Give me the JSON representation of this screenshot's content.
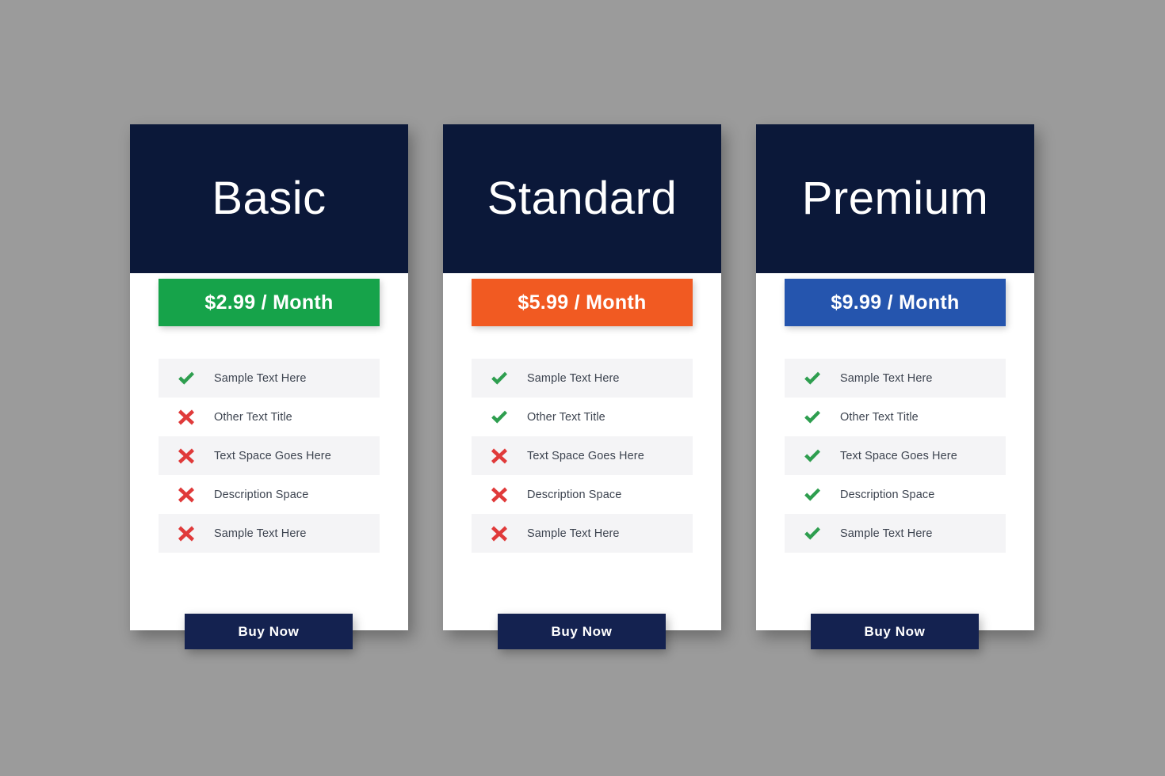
{
  "page": {
    "background_color": "#9b9b9b",
    "card_background": "#ffffff",
    "header_color": "#0b1839",
    "button_color": "#142250",
    "row_shade_color": "#f4f4f6",
    "label_color": "#3d4450",
    "check_color": "#2e9e4f",
    "cross_color": "#e03a3a"
  },
  "plans": [
    {
      "title": "Basic",
      "price": "$2.99 / Month",
      "accent_color": "#16a34a",
      "buy_label": "Buy Now",
      "features": [
        {
          "label": "Sample Text Here",
          "included": true
        },
        {
          "label": "Other Text Title",
          "included": false
        },
        {
          "label": "Text Space Goes Here",
          "included": false
        },
        {
          "label": "Description Space",
          "included": false
        },
        {
          "label": "Sample Text Here",
          "included": false
        }
      ]
    },
    {
      "title": "Standard",
      "price": "$5.99 / Month",
      "accent_color": "#f15a22",
      "buy_label": "Buy Now",
      "features": [
        {
          "label": "Sample Text Here",
          "included": true
        },
        {
          "label": "Other Text Title",
          "included": true
        },
        {
          "label": "Text Space Goes Here",
          "included": false
        },
        {
          "label": "Description Space",
          "included": false
        },
        {
          "label": "Sample Text Here",
          "included": false
        }
      ]
    },
    {
      "title": "Premium",
      "price": "$9.99 / Month",
      "accent_color": "#2555ae",
      "buy_label": "Buy Now",
      "features": [
        {
          "label": "Sample Text Here",
          "included": true
        },
        {
          "label": "Other Text Title",
          "included": true
        },
        {
          "label": "Text Space Goes Here",
          "included": true
        },
        {
          "label": "Description Space",
          "included": true
        },
        {
          "label": "Sample Text Here",
          "included": true
        }
      ]
    }
  ],
  "icons": {
    "check": "check-icon",
    "cross": "cross-icon"
  }
}
